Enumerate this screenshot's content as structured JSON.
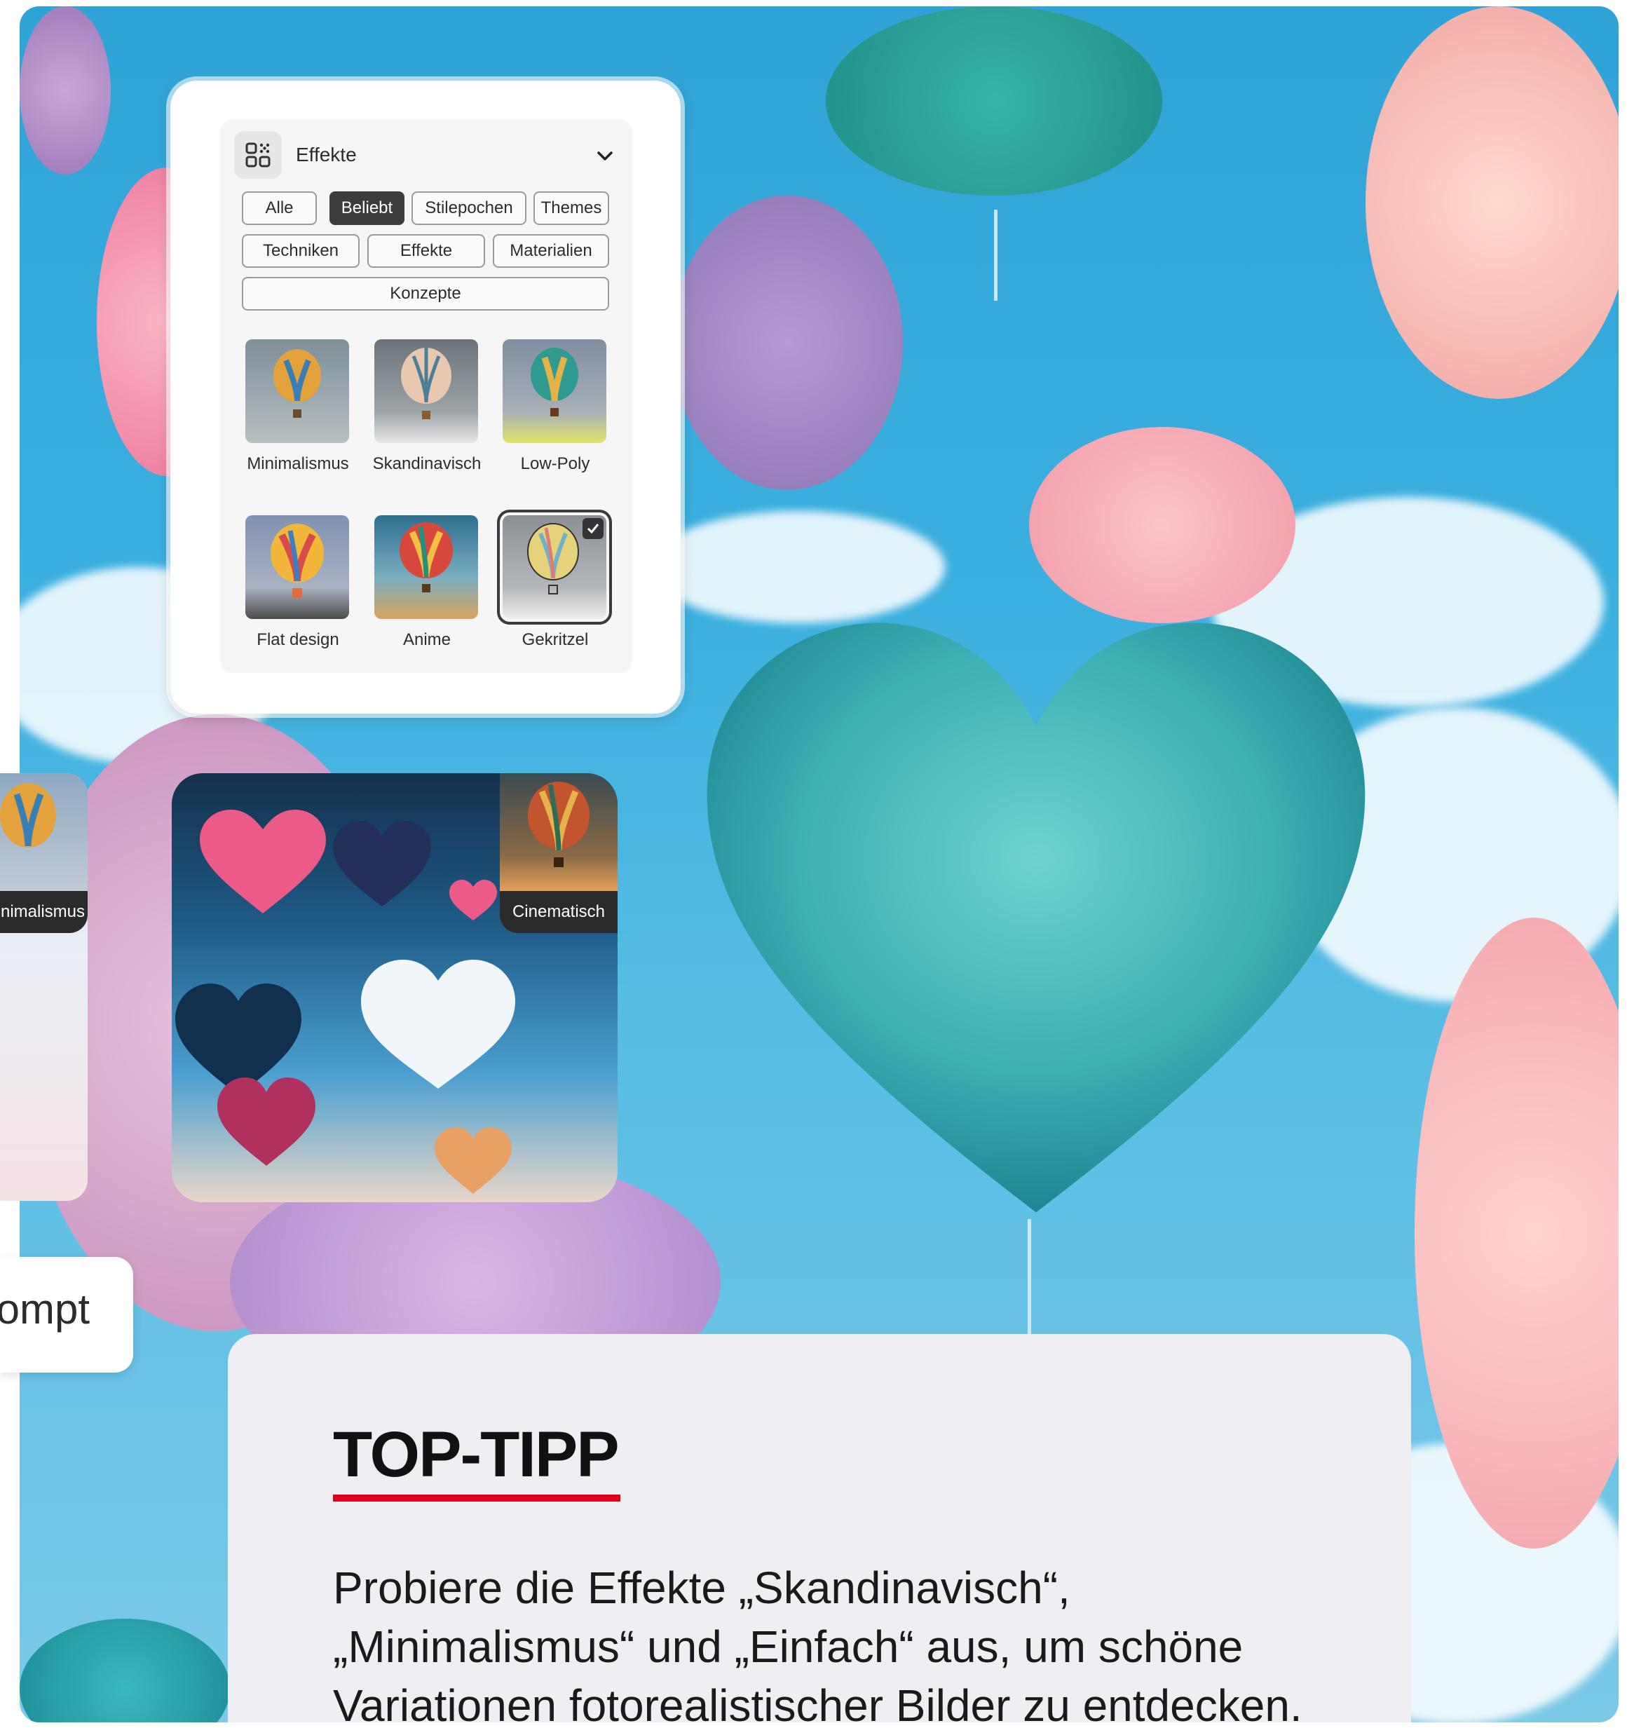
{
  "panel": {
    "title": "Effekte",
    "filters": [
      {
        "label": "Alle",
        "active": false
      },
      {
        "label": "Beliebt",
        "active": true
      },
      {
        "label": "Stilepochen",
        "active": false
      },
      {
        "label": "Themes",
        "active": false
      },
      {
        "label": "Techniken",
        "active": false
      },
      {
        "label": "Effekte",
        "active": false
      },
      {
        "label": "Materialien",
        "active": false
      },
      {
        "label": "Konzepte",
        "active": false
      }
    ],
    "styles": [
      {
        "label": "Minimalismus",
        "selected": false
      },
      {
        "label": "Skandinavisch",
        "selected": false
      },
      {
        "label": "Low-Poly",
        "selected": false
      },
      {
        "label": "Flat design",
        "selected": false
      },
      {
        "label": "Anime",
        "selected": false
      },
      {
        "label": "Gekritzel",
        "selected": true
      }
    ]
  },
  "cards": {
    "left_label": "Minimalismus",
    "main_label": "Cinematisch"
  },
  "prompt": {
    "text": "Prompt"
  },
  "tip": {
    "title": "TOP-TIPP",
    "body": "Probiere die Effekte „Skandinavisch“, „Minimalismus“ und „Einfach“ aus, um schöne Variationen fotorealistischer Bilder zu entdecken."
  },
  "colors": {
    "accent_red": "#e3001b",
    "chip_active": "#3c3c3c",
    "sky_blue": "#3cb0e0",
    "heart_teal": "#45b9c1"
  }
}
